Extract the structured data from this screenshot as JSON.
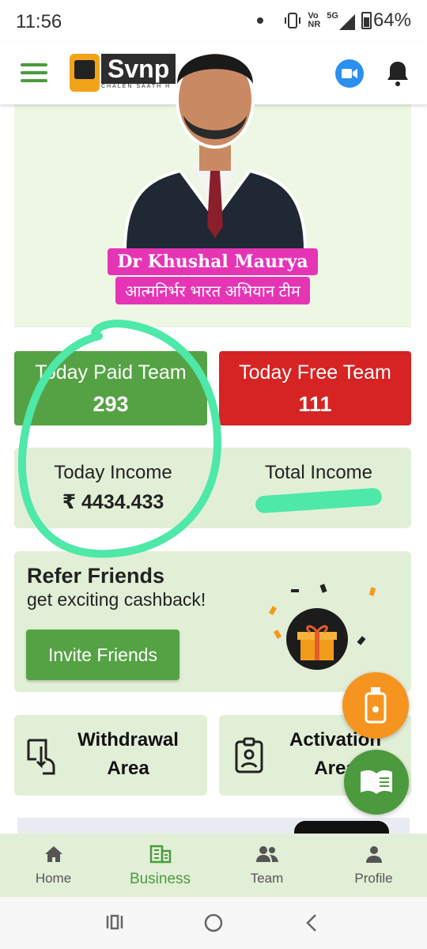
{
  "status_bar": {
    "time": "11:56",
    "network_top": "Vo",
    "network_bottom": "NR",
    "network_type": "5G",
    "battery": "64%"
  },
  "header": {
    "logo_text": "Svnp",
    "logo_subtitle": "CHALEN SAATH H",
    "accent_color": "#4c9a3e"
  },
  "banner": {
    "name": "Dr Khushal Maurya",
    "tagline": "आत्मनिर्भर भारत अभियान टीम"
  },
  "stats": {
    "paid_label": "Today Paid Team",
    "paid_value": "293",
    "free_label": "Today Free Team",
    "free_value": "111"
  },
  "income": {
    "today_label": "Today Income",
    "today_value": "₹ 4434.433",
    "total_label": "Total Income"
  },
  "refer": {
    "title": "Refer Friends",
    "subtitle": "get exciting cashback!",
    "button": "Invite Friends"
  },
  "actions": {
    "withdraw_line1": "Withdrawal",
    "withdraw_line2": "Area",
    "activation_line1": "Activation",
    "activation_line2": "Area"
  },
  "bottom_nav": {
    "items": [
      {
        "label": "Home",
        "icon": "home-icon"
      },
      {
        "label": "Business",
        "icon": "business-icon"
      },
      {
        "label": "Team",
        "icon": "team-icon"
      },
      {
        "label": "Profile",
        "icon": "profile-icon"
      }
    ],
    "active": "Business"
  }
}
